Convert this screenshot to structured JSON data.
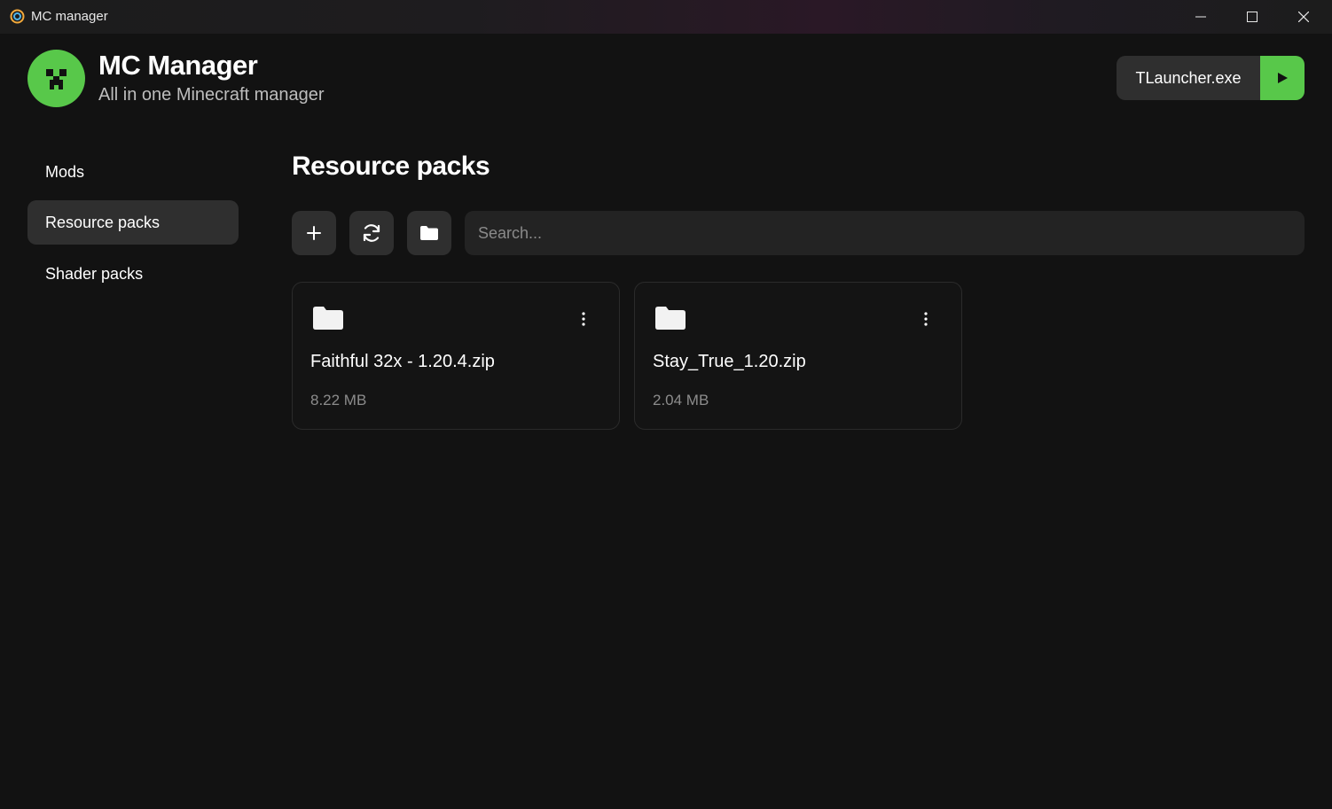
{
  "window": {
    "title": "MC manager"
  },
  "header": {
    "title": "MC Manager",
    "subtitle": "All in one Minecraft manager",
    "launcher_name": "TLauncher.exe",
    "accent_color": "#58c84a"
  },
  "sidebar": {
    "items": [
      {
        "label": "Mods",
        "active": false
      },
      {
        "label": "Resource packs",
        "active": true
      },
      {
        "label": "Shader packs",
        "active": false
      }
    ]
  },
  "main": {
    "title": "Resource packs",
    "toolbar": {
      "add_icon": "plus-icon",
      "refresh_icon": "refresh-icon",
      "folder_icon": "folder-icon"
    },
    "search": {
      "placeholder": "Search...",
      "value": ""
    },
    "packs": [
      {
        "name": "Faithful 32x - 1.20.4.zip",
        "size": "8.22 MB"
      },
      {
        "name": "Stay_True_1.20.zip",
        "size": "2.04 MB"
      }
    ]
  }
}
